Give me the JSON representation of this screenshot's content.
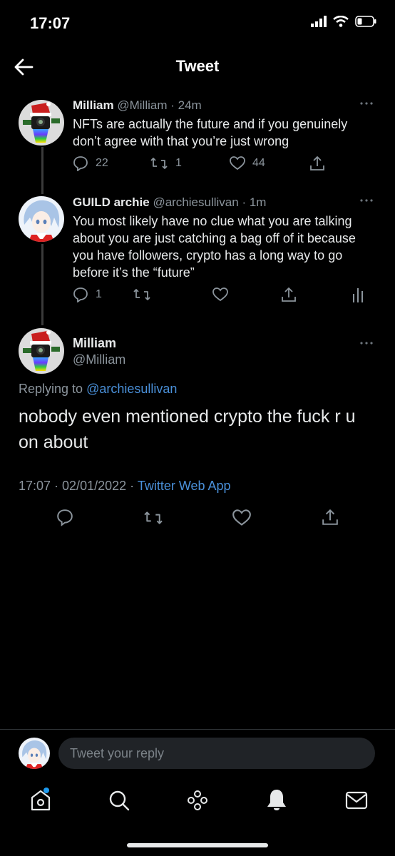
{
  "status_bar": {
    "time": "17:07"
  },
  "header": {
    "title": "Tweet"
  },
  "tweets": [
    {
      "name": "Milliam",
      "handle": "@Milliam",
      "time": "· 24m",
      "text": "NFTs are actually the future and if you genuinely don’t agree with that you’re just wrong",
      "replies": "22",
      "retweets": "1",
      "likes": "44"
    },
    {
      "name": "GUILD archie",
      "handle": "@archiesullivan",
      "time": "· 1m",
      "text": "You most likely have no clue what you are talking about you are just catching a bag off of it because you have followers, crypto has a long way to go before it’s the “future”",
      "replies": "1"
    }
  ],
  "main_tweet": {
    "name": "Milliam",
    "handle": "@Milliam",
    "replying_prefix": "Replying to",
    "replying_to": "@archiesullivan",
    "text": "nobody even mentioned crypto the fuck r u on about",
    "timestamp": "17:07 · 02/01/2022 ·",
    "source": "Twitter Web App"
  },
  "reply_box": {
    "placeholder": "Tweet your reply"
  },
  "colors": {
    "background": "#000000",
    "text": "#e7e9ea",
    "muted": "#8b949c",
    "link": "#4a90d9",
    "notification_dot": "#1d9bf0"
  },
  "icons": [
    "back-arrow-icon",
    "signal-icon",
    "wifi-icon",
    "battery-icon",
    "more-icon",
    "reply-icon",
    "retweet-icon",
    "like-icon",
    "share-icon",
    "analytics-icon",
    "home-icon",
    "search-icon",
    "spaces-icon",
    "notifications-icon",
    "messages-icon"
  ]
}
